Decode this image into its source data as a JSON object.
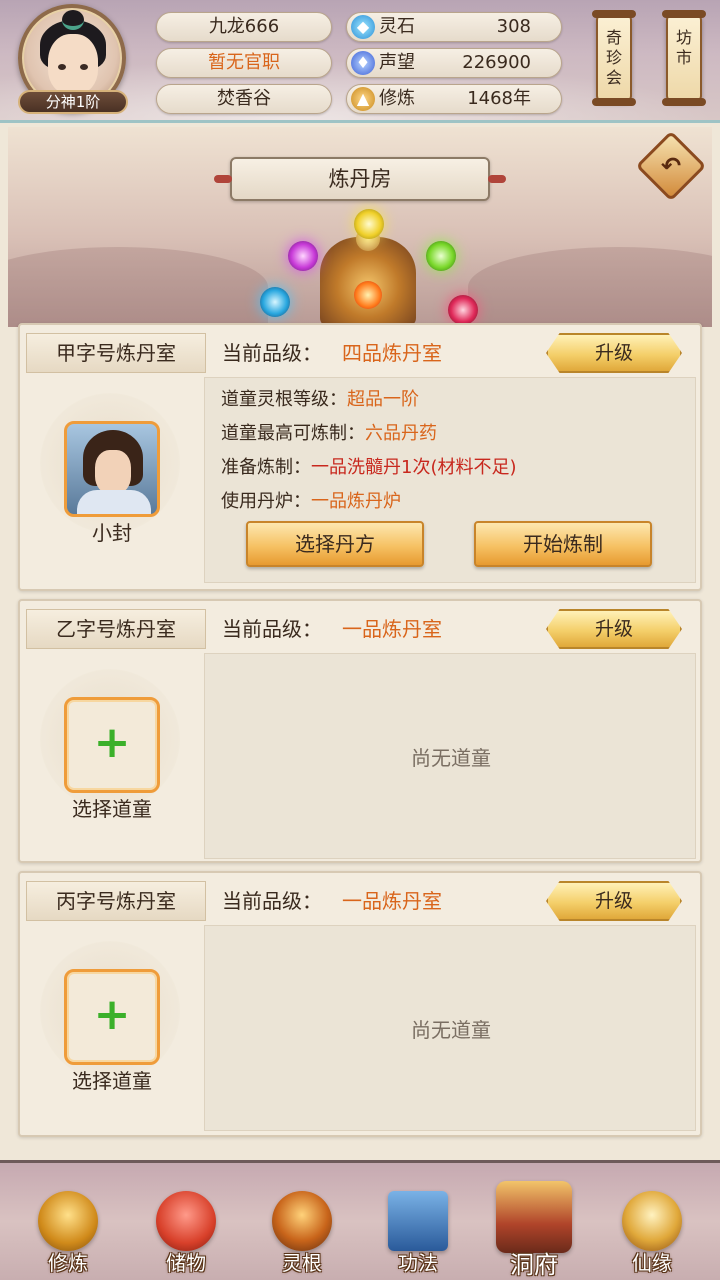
{
  "player": {
    "name": "九龙666",
    "official_title": "暂无官职",
    "sect": "焚香谷",
    "rank": "分神1阶"
  },
  "resources": [
    {
      "icon": "spirit-stone-icon",
      "label": "灵石",
      "value": "308"
    },
    {
      "icon": "reputation-icon",
      "label": "声望",
      "value": "226900"
    },
    {
      "icon": "cultivation-icon",
      "label": "修炼",
      "value": "1468年"
    }
  ],
  "side_buttons": {
    "qizhenhui": "奇珍会",
    "fangshi": "坊市"
  },
  "page": {
    "title": "炼丹房"
  },
  "rooms": [
    {
      "name": "甲字号炼丹室",
      "grade_label": "当前品级：",
      "grade_value": "四品炼丹室",
      "upgrade_label": "升级",
      "apprentice_name": "小封",
      "details": {
        "root_label": "道童灵根等级：",
        "root_value": "超品一阶",
        "max_label": "道童最高可炼制：",
        "max_value": "六品丹药",
        "prep_label": "准备炼制：",
        "prep_value": "一品洗髓丹1次(材料不足)",
        "furnace_label": "使用丹炉：",
        "furnace_value": "一品炼丹炉"
      },
      "select_recipe_label": "选择丹方",
      "start_label": "开始炼制"
    },
    {
      "name": "乙字号炼丹室",
      "grade_label": "当前品级：",
      "grade_value": "一品炼丹室",
      "upgrade_label": "升级",
      "empty_text": "尚无道童",
      "select_label": "选择道童"
    },
    {
      "name": "丙字号炼丹室",
      "grade_label": "当前品级：",
      "grade_value": "一品炼丹室",
      "upgrade_label": "升级",
      "empty_text": "尚无道童",
      "select_label": "选择道童"
    }
  ],
  "bottom_nav": [
    {
      "label": "修炼",
      "icon": "meditation-icon"
    },
    {
      "label": "储物",
      "icon": "storage-bag-icon"
    },
    {
      "label": "灵根",
      "icon": "spirit-root-icon"
    },
    {
      "label": "功法",
      "icon": "scripture-book-icon"
    },
    {
      "label": "洞府",
      "icon": "cave-abode-icon",
      "active": true
    },
    {
      "label": "仙缘",
      "icon": "immortal-fate-icon"
    }
  ],
  "colors": {
    "accent_orange": "#d9651b",
    "warning_red": "#c8281e",
    "plus_green": "#3bb02a",
    "slot_border": "#ef9c3a"
  }
}
